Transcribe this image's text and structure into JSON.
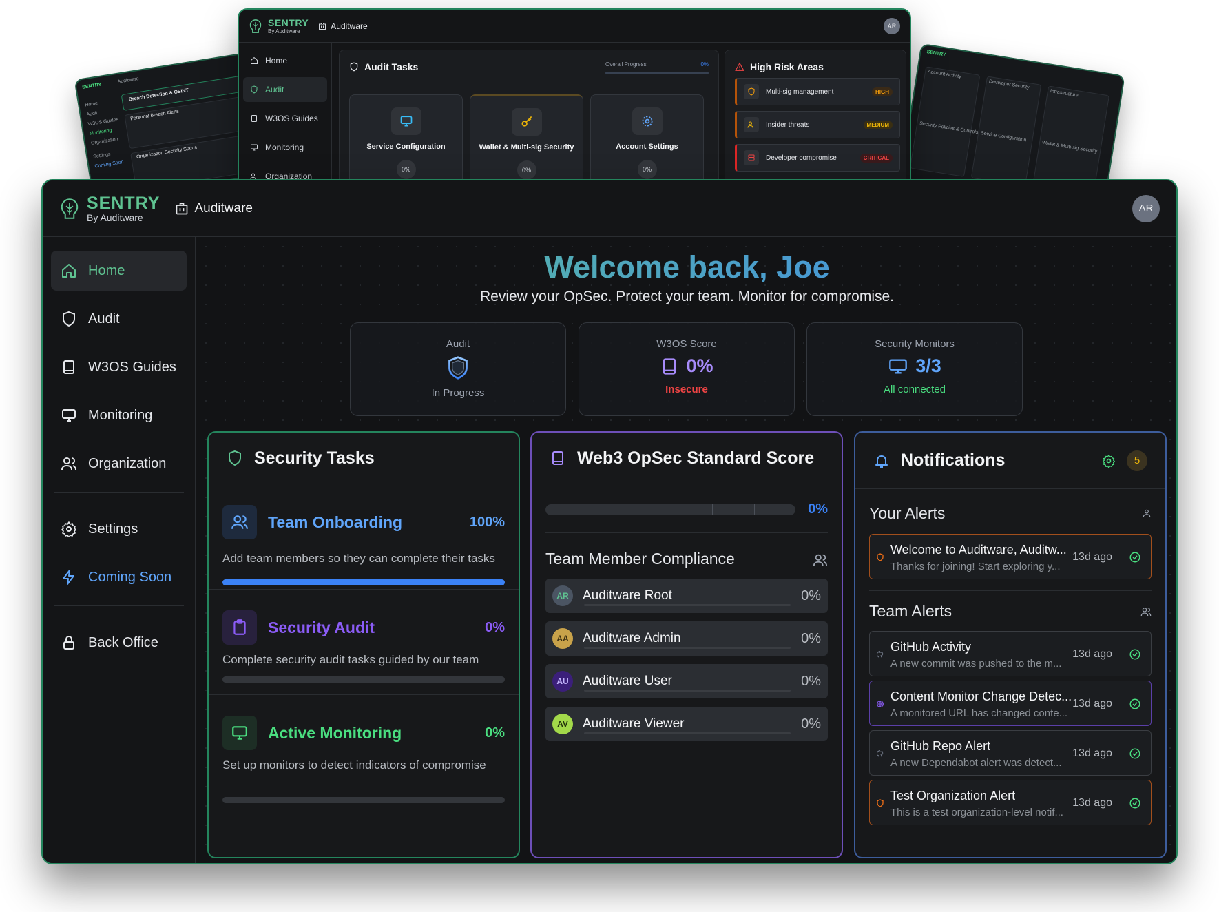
{
  "brand": {
    "name": "SENTRY",
    "tagline": "By Auditware",
    "org": "Auditware",
    "user_initials": "AR",
    "accent": "#5fc391"
  },
  "sidebar": {
    "items": [
      {
        "label": "Home",
        "icon": "home-icon",
        "active": true
      },
      {
        "label": "Audit",
        "icon": "shield-icon"
      },
      {
        "label": "W3OS Guides",
        "icon": "book-icon"
      },
      {
        "label": "Monitoring",
        "icon": "monitor-icon"
      },
      {
        "label": "Organization",
        "icon": "users-icon"
      },
      {
        "label": "Settings",
        "icon": "gear-icon"
      },
      {
        "label": "Coming Soon",
        "icon": "lightning-icon"
      },
      {
        "label": "Back Office",
        "icon": "lock-icon"
      }
    ]
  },
  "welcome": {
    "title": "Welcome back, Joe",
    "subtitle": "Review your OpSec.  Protect your team.  Monitor for compromise."
  },
  "stats": [
    {
      "label": "Audit",
      "value": "",
      "sub": "In Progress",
      "sub_color": "#9ca3af"
    },
    {
      "label": "W3OS Score",
      "value": "0%",
      "sub": "Insecure",
      "sub_color": "#ef4444"
    },
    {
      "label": "Security Monitors",
      "value": "3/3",
      "sub": "All connected",
      "sub_color": "#4ade80"
    }
  ],
  "security_tasks": {
    "title": "Security Tasks",
    "tasks": [
      {
        "name": "Team Onboarding",
        "pct": "100%",
        "progress": 1.0,
        "desc": "Add team members so they can complete their tasks",
        "color": "#60a5fa"
      },
      {
        "name": "Security Audit",
        "pct": "0%",
        "progress": 0,
        "desc": "Complete security audit tasks guided by our team",
        "color": "#8b5cf6"
      },
      {
        "name": "Active Monitoring",
        "pct": "0%",
        "progress": 0,
        "desc": "Set up monitors to detect indicators of compromise",
        "color": "#4ade80"
      }
    ]
  },
  "score": {
    "title": "Web3 OpSec Standard Score",
    "pct": "0%",
    "progress": 0,
    "compliance_title": "Team Member Compliance",
    "members": [
      {
        "initials": "AR",
        "name": "Auditware Root",
        "pct": "0%",
        "bg": "#4b5563",
        "fg": "#5fc391"
      },
      {
        "initials": "AA",
        "name": "Auditware Admin",
        "pct": "0%",
        "bg": "#c8a24a",
        "fg": "#3b2f12"
      },
      {
        "initials": "AU",
        "name": "Auditware User",
        "pct": "0%",
        "bg": "#3b1f7a",
        "fg": "#c4b5fd"
      },
      {
        "initials": "AV",
        "name": "Auditware Viewer",
        "pct": "0%",
        "bg": "#a3d94a",
        "fg": "#24330d"
      }
    ]
  },
  "notifications": {
    "title": "Notifications",
    "count": "5",
    "your_alerts_title": "Your Alerts",
    "team_alerts_title": "Team Alerts",
    "your_alerts": [
      {
        "title": "Welcome to Auditware, Auditw...",
        "desc": "Thanks for joining! Start exploring y...",
        "time": "13d ago",
        "style": "orange"
      }
    ],
    "team_alerts": [
      {
        "title": "GitHub Activity",
        "desc": "A new commit was pushed to the m...",
        "time": "13d ago",
        "style": "gray"
      },
      {
        "title": "Content Monitor Change Detec...",
        "desc": "A monitored URL has changed conte...",
        "time": "13d ago",
        "style": "purp"
      },
      {
        "title": "GitHub Repo Alert",
        "desc": "A new Dependabot alert was detect...",
        "time": "13d ago",
        "style": "gray"
      },
      {
        "title": "Test Organization Alert",
        "desc": "This is a test organization-level notif...",
        "time": "13d ago",
        "style": "orange"
      }
    ]
  },
  "preview": {
    "nav": [
      "Home",
      "Audit",
      "W3OS Guides",
      "Monitoring",
      "Organization"
    ],
    "audit_tasks_title": "Audit Tasks",
    "overall_progress_label": "Overall Progress",
    "overall_progress_pct": "0%",
    "tiles": [
      {
        "name": "Service Configuration",
        "pct": "0%"
      },
      {
        "name": "Wallet & Multi-sig Security",
        "pct": "0%"
      },
      {
        "name": "Account Settings",
        "pct": "0%"
      }
    ],
    "risk_title": "High Risk Areas",
    "risks": [
      {
        "name": "Multi-sig management",
        "level": "HIGH"
      },
      {
        "name": "Insider threats",
        "level": "MEDIUM"
      },
      {
        "name": "Developer compromise",
        "level": "CRITICAL"
      }
    ],
    "left": {
      "card_title": "Breach Detection & OSINT",
      "card_sub": "Personal Breach Alerts",
      "org_status": "Organization Security Status",
      "nav": [
        "Home",
        "Audit",
        "W3OS Guides",
        "Monitoring",
        "Organization",
        "Settings",
        "Coming Soon"
      ]
    },
    "right": {
      "labels": [
        "Account Activity",
        "Developer Security",
        "Infrastructure",
        "Security Policies & Controls",
        "Service Configuration",
        "Wallet & Multi-sig Security"
      ]
    }
  }
}
